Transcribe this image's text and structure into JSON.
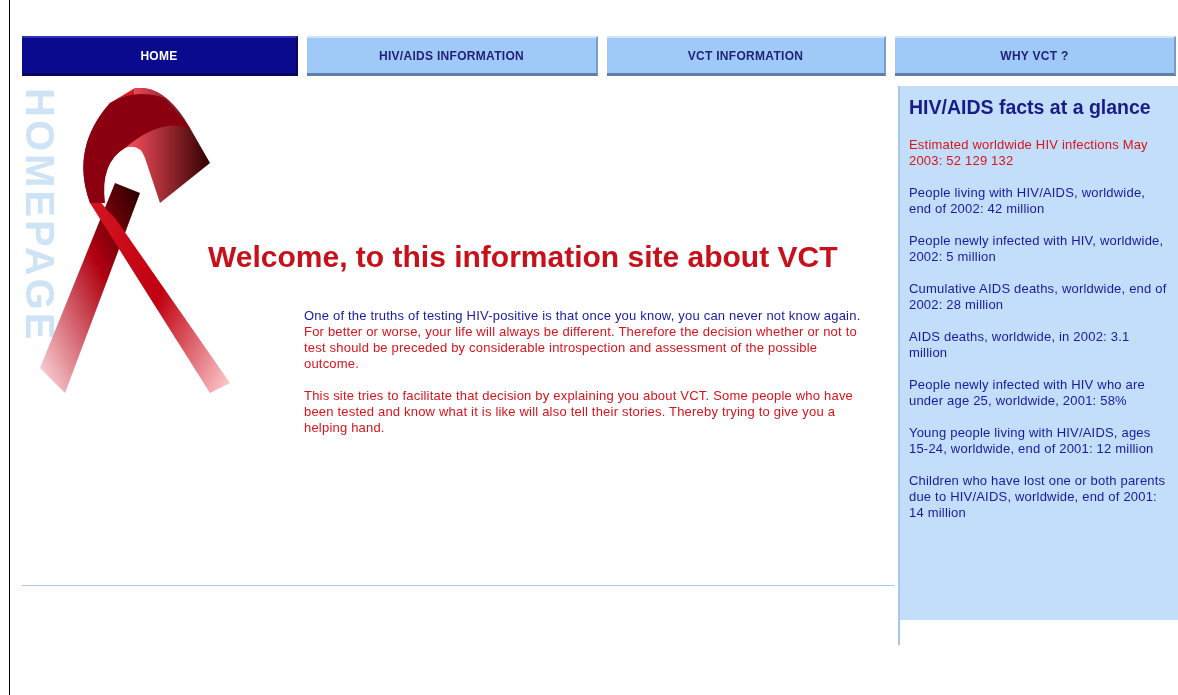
{
  "nav": {
    "tabs": [
      {
        "label": "HOME",
        "selected": true
      },
      {
        "label": "HIV/AIDS INFORMATION",
        "selected": false
      },
      {
        "label": "VCT INFORMATION",
        "selected": false
      },
      {
        "label": "WHY VCT ?",
        "selected": false
      }
    ]
  },
  "main": {
    "watermark": "HOMEPAGE",
    "heading": "Welcome, to this information site about VCT",
    "paragraphs": [
      [
        {
          "text": "One of the truths of testing HIV-positive is that once you know, you can never not know again.",
          "color": "#1a1aa0"
        },
        {
          "text": "For better or worse, your life will always be different. Therefore the decision whether or not to test should be preceded by considerable introspection and assessment of the possible outcome.",
          "color": "#d8141c"
        }
      ],
      [
        {
          "text": "This site tries to facilitate that decision by explaining you about VCT. Some people who have been tested and know what it is like will also tell their stories. Thereby trying to give you a helping hand.",
          "color": "#d8141c"
        }
      ]
    ]
  },
  "sidebar": {
    "title": "HIV/AIDS facts at a glance",
    "facts": [
      {
        "text": "Estimated worldwide HIV infections May 2003: 52 129 132",
        "color": "#d8141c"
      },
      {
        "text": "People living with HIV/AIDS, worldwide, end of 2002: 42 million",
        "color": "#1a1aa0"
      },
      {
        "text": "People newly infected with HIV, worldwide, 2002: 5 million",
        "color": "#1a1aa0"
      },
      {
        "text": "Cumulative AIDS deaths, worldwide, end of 2002: 28 million",
        "color": "#1a1aa0"
      },
      {
        "text": "AIDS deaths, worldwide, in 2002: 3.1 million",
        "color": "#1a1aa0"
      },
      {
        "text": "People newly infected with HIV who are under age 25, worldwide, 2001: 58%",
        "color": "#1a1aa0"
      },
      {
        "text": "Young people living with HIV/AIDS, ages 15-24, worldwide, end of 2001: 12 million",
        "color": "#1a1aa0"
      },
      {
        "text": "Children who have lost one or both parents due to HIV/AIDS, worldwide, end of 2001: 14 million",
        "color": "#1a1aa0"
      }
    ]
  }
}
